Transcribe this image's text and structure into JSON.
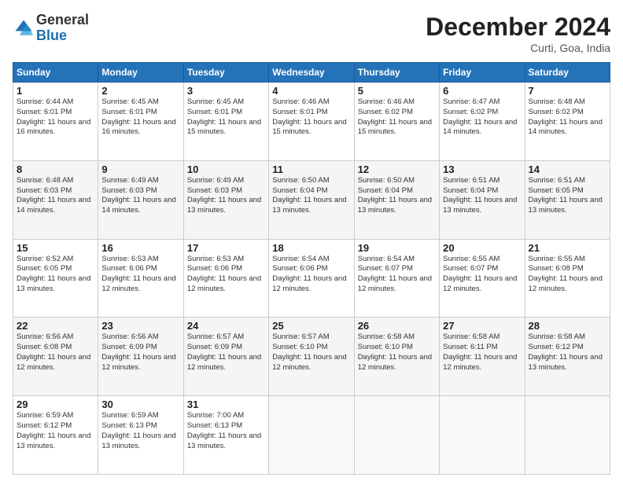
{
  "header": {
    "logo_line1": "General",
    "logo_line2": "Blue",
    "main_title": "December 2024",
    "subtitle": "Curti, Goa, India"
  },
  "days_header": [
    "Sunday",
    "Monday",
    "Tuesday",
    "Wednesday",
    "Thursday",
    "Friday",
    "Saturday"
  ],
  "weeks": [
    [
      {
        "day": "1",
        "sunrise": "6:44 AM",
        "sunset": "6:01 PM",
        "daylight": "11 hours and 16 minutes."
      },
      {
        "day": "2",
        "sunrise": "6:45 AM",
        "sunset": "6:01 PM",
        "daylight": "11 hours and 16 minutes."
      },
      {
        "day": "3",
        "sunrise": "6:45 AM",
        "sunset": "6:01 PM",
        "daylight": "11 hours and 15 minutes."
      },
      {
        "day": "4",
        "sunrise": "6:46 AM",
        "sunset": "6:01 PM",
        "daylight": "11 hours and 15 minutes."
      },
      {
        "day": "5",
        "sunrise": "6:46 AM",
        "sunset": "6:02 PM",
        "daylight": "11 hours and 15 minutes."
      },
      {
        "day": "6",
        "sunrise": "6:47 AM",
        "sunset": "6:02 PM",
        "daylight": "11 hours and 14 minutes."
      },
      {
        "day": "7",
        "sunrise": "6:48 AM",
        "sunset": "6:02 PM",
        "daylight": "11 hours and 14 minutes."
      }
    ],
    [
      {
        "day": "8",
        "sunrise": "6:48 AM",
        "sunset": "6:03 PM",
        "daylight": "11 hours and 14 minutes."
      },
      {
        "day": "9",
        "sunrise": "6:49 AM",
        "sunset": "6:03 PM",
        "daylight": "11 hours and 14 minutes."
      },
      {
        "day": "10",
        "sunrise": "6:49 AM",
        "sunset": "6:03 PM",
        "daylight": "11 hours and 13 minutes."
      },
      {
        "day": "11",
        "sunrise": "6:50 AM",
        "sunset": "6:04 PM",
        "daylight": "11 hours and 13 minutes."
      },
      {
        "day": "12",
        "sunrise": "6:50 AM",
        "sunset": "6:04 PM",
        "daylight": "11 hours and 13 minutes."
      },
      {
        "day": "13",
        "sunrise": "6:51 AM",
        "sunset": "6:04 PM",
        "daylight": "11 hours and 13 minutes."
      },
      {
        "day": "14",
        "sunrise": "6:51 AM",
        "sunset": "6:05 PM",
        "daylight": "11 hours and 13 minutes."
      }
    ],
    [
      {
        "day": "15",
        "sunrise": "6:52 AM",
        "sunset": "6:05 PM",
        "daylight": "11 hours and 13 minutes."
      },
      {
        "day": "16",
        "sunrise": "6:53 AM",
        "sunset": "6:06 PM",
        "daylight": "11 hours and 12 minutes."
      },
      {
        "day": "17",
        "sunrise": "6:53 AM",
        "sunset": "6:06 PM",
        "daylight": "11 hours and 12 minutes."
      },
      {
        "day": "18",
        "sunrise": "6:54 AM",
        "sunset": "6:06 PM",
        "daylight": "11 hours and 12 minutes."
      },
      {
        "day": "19",
        "sunrise": "6:54 AM",
        "sunset": "6:07 PM",
        "daylight": "11 hours and 12 minutes."
      },
      {
        "day": "20",
        "sunrise": "6:55 AM",
        "sunset": "6:07 PM",
        "daylight": "11 hours and 12 minutes."
      },
      {
        "day": "21",
        "sunrise": "6:55 AM",
        "sunset": "6:08 PM",
        "daylight": "11 hours and 12 minutes."
      }
    ],
    [
      {
        "day": "22",
        "sunrise": "6:56 AM",
        "sunset": "6:08 PM",
        "daylight": "11 hours and 12 minutes."
      },
      {
        "day": "23",
        "sunrise": "6:56 AM",
        "sunset": "6:09 PM",
        "daylight": "11 hours and 12 minutes."
      },
      {
        "day": "24",
        "sunrise": "6:57 AM",
        "sunset": "6:09 PM",
        "daylight": "11 hours and 12 minutes."
      },
      {
        "day": "25",
        "sunrise": "6:57 AM",
        "sunset": "6:10 PM",
        "daylight": "11 hours and 12 minutes."
      },
      {
        "day": "26",
        "sunrise": "6:58 AM",
        "sunset": "6:10 PM",
        "daylight": "11 hours and 12 minutes."
      },
      {
        "day": "27",
        "sunrise": "6:58 AM",
        "sunset": "6:11 PM",
        "daylight": "11 hours and 12 minutes."
      },
      {
        "day": "28",
        "sunrise": "6:58 AM",
        "sunset": "6:12 PM",
        "daylight": "11 hours and 13 minutes."
      }
    ],
    [
      {
        "day": "29",
        "sunrise": "6:59 AM",
        "sunset": "6:12 PM",
        "daylight": "11 hours and 13 minutes."
      },
      {
        "day": "30",
        "sunrise": "6:59 AM",
        "sunset": "6:13 PM",
        "daylight": "11 hours and 13 minutes."
      },
      {
        "day": "31",
        "sunrise": "7:00 AM",
        "sunset": "6:13 PM",
        "daylight": "11 hours and 13 minutes."
      },
      null,
      null,
      null,
      null
    ]
  ]
}
